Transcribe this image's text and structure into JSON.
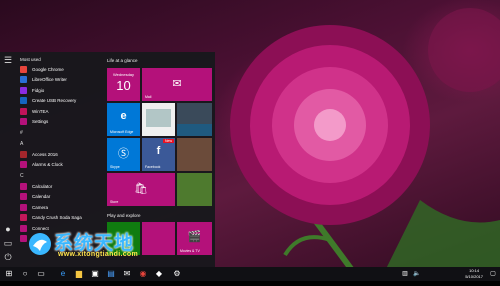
{
  "start_menu": {
    "most_used_header": "Most used",
    "most_used": [
      {
        "label": "Google Chrome",
        "color": "#e8453c"
      },
      {
        "label": "LibreOffice Writer",
        "color": "#2a6fd6"
      },
      {
        "label": "Fidgio",
        "color": "#8a2be2"
      },
      {
        "label": "Create USB Recovery",
        "color": "#1565c0"
      },
      {
        "label": "WinTEA",
        "color": "#c0135a"
      },
      {
        "label": "Settings",
        "color": "#b4117a"
      }
    ],
    "letter_hash": "#",
    "letter_a": "A",
    "a_apps": [
      {
        "label": "Access 2016",
        "color": "#a4262c"
      },
      {
        "label": "Alarms & Clock",
        "color": "#b4117a"
      }
    ],
    "letter_c": "C",
    "c_apps": [
      {
        "label": "Calculator",
        "color": "#b4117a"
      },
      {
        "label": "Calendar",
        "color": "#b4117a"
      },
      {
        "label": "Camera",
        "color": "#b4117a"
      },
      {
        "label": "Candy Crush Soda Saga",
        "color": "#c2185b"
      },
      {
        "label": "Connect",
        "color": "#b4117a"
      },
      {
        "label": "Cortana",
        "color": "#b4117a"
      }
    ],
    "tiles_group1": "Life at a glance",
    "tiles_group2": "Play and explore",
    "tiles": {
      "calendar_day": "Wednesday",
      "calendar_date": "10",
      "mail": "Mail",
      "edge": "Microsoft Edge",
      "skype": "Skype",
      "facebook": "Facebook",
      "facebook_badge": "New",
      "store": "Store",
      "movies": "Movies & TV"
    }
  },
  "taskbar": {
    "time": "10:14",
    "date": "5/10/2017"
  },
  "watermark": {
    "title": "系统天地",
    "url": "www.xitongtiandi.com"
  },
  "colors": {
    "accent": "#b4117a",
    "tile_magenta": "#b4117a",
    "tile_blue": "#0078d7",
    "taskbar": "#101014"
  }
}
